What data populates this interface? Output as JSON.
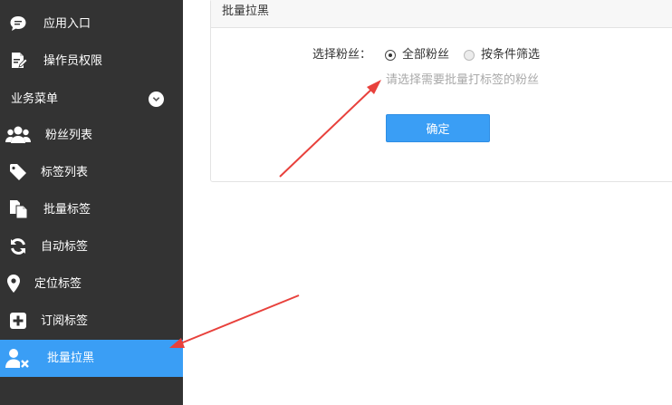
{
  "sidebar": {
    "items_top": [
      {
        "label": "应用入口",
        "icon": "chat-bubble-icon"
      },
      {
        "label": "操作员权限",
        "icon": "edit-document-icon"
      }
    ],
    "section": {
      "label": "业务菜单",
      "icon": "chevron-down-icon"
    },
    "items": [
      {
        "label": "粉丝列表",
        "icon": "users-icon"
      },
      {
        "label": "标签列表",
        "icon": "tag-icon"
      },
      {
        "label": "批量标签",
        "icon": "documents-icon"
      },
      {
        "label": "自动标签",
        "icon": "refresh-icon"
      },
      {
        "label": "定位标签",
        "icon": "map-marker-icon"
      },
      {
        "label": "订阅标签",
        "icon": "plus-square-icon"
      },
      {
        "label": "批量拉黑",
        "icon": "user-remove-icon",
        "active": true
      }
    ],
    "active_color": "#3a9ef5",
    "background_color": "#333333"
  },
  "panel": {
    "title": "批量拉黑",
    "field_label": "选择粉丝：",
    "radio_options": [
      {
        "label": "全部粉丝",
        "checked": true
      },
      {
        "label": "按条件筛选",
        "checked": false
      }
    ],
    "hint": "请选择需要批量打标签的粉丝",
    "confirm_label": "确定"
  },
  "annotation_color": "#e8413c"
}
